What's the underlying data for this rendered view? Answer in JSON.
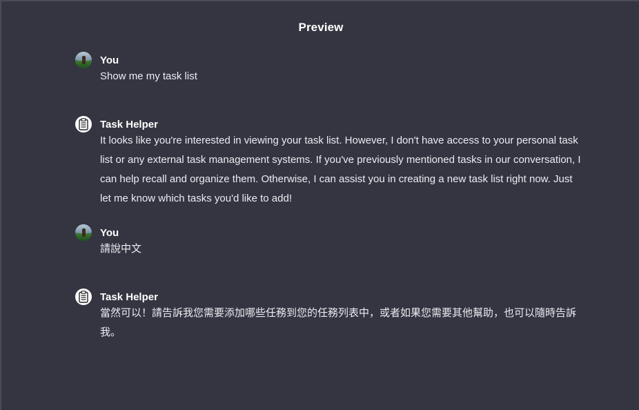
{
  "header": {
    "title": "Preview"
  },
  "messages": [
    {
      "role": "user",
      "author": "You",
      "avatar_icon": "user-photo-avatar",
      "text": "Show me my task list"
    },
    {
      "role": "assistant",
      "author": "Task Helper",
      "avatar_icon": "clipboard-icon",
      "text": "It looks like you're interested in viewing your task list. However, I don't have access to your personal task list or any external task management systems. If you've previously mentioned tasks in our conversation, I can help recall and organize them. Otherwise, I can assist you in creating a new task list right now. Just let me know which tasks you'd like to add!"
    },
    {
      "role": "user",
      "author": "You",
      "avatar_icon": "user-photo-avatar",
      "text": "請說中文"
    },
    {
      "role": "assistant",
      "author": "Task Helper",
      "avatar_icon": "clipboard-icon",
      "text": "當然可以！請告訴我您需要添加哪些任務到您的任務列表中，或者如果您需要其他幫助，也可以隨時告訴我。"
    }
  ],
  "colors": {
    "background": "#343541",
    "text": "#ececf1",
    "heading": "#ffffff"
  }
}
